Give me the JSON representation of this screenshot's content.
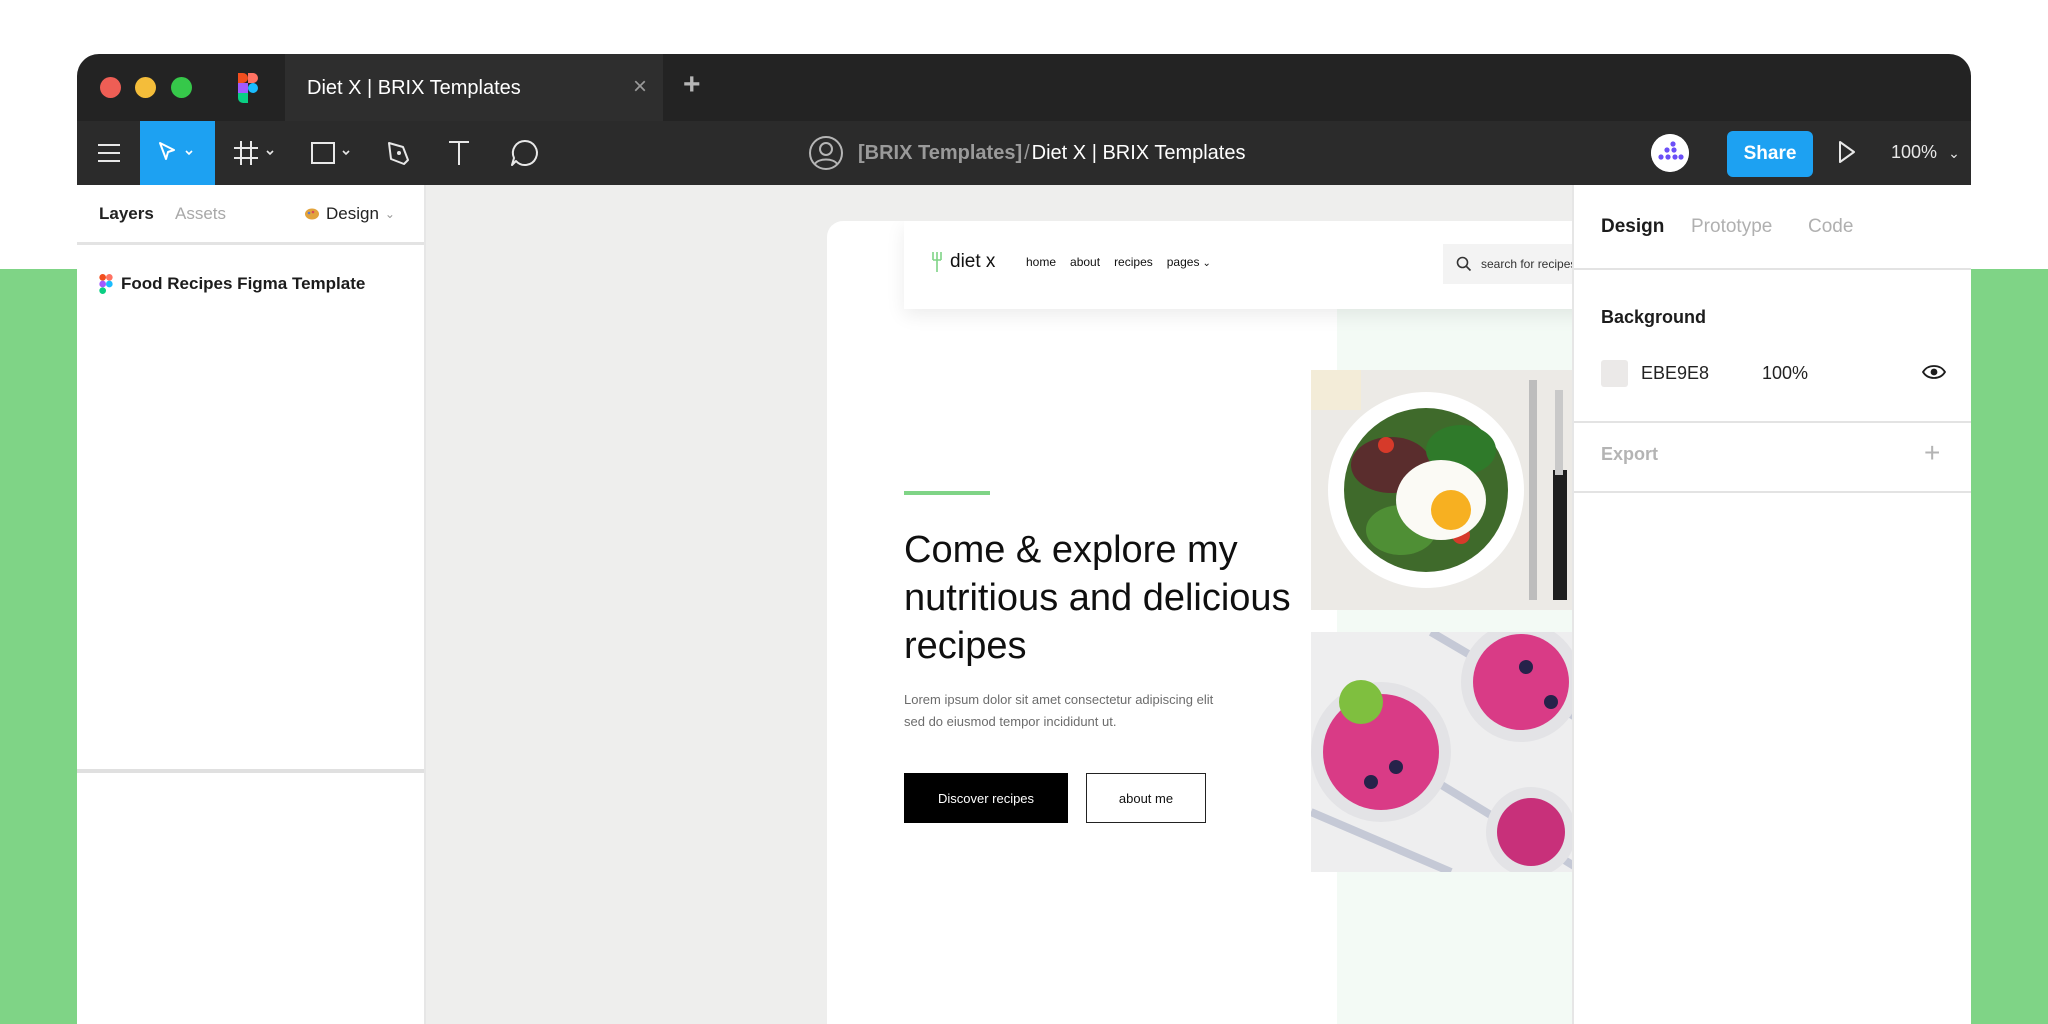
{
  "tab": {
    "title": "Diet X | BRIX Templates",
    "close_icon": "close-icon",
    "add_icon": "plus-icon"
  },
  "toolbar": {
    "breadcrumb_team": "[BRIX Templates]",
    "breadcrumb_sep": "/",
    "breadcrumb_file": "Diet X | BRIX Templates",
    "share_label": "Share",
    "zoom": "100%",
    "accent": "#1da1f2"
  },
  "left_panel": {
    "tab_layers": "Layers",
    "tab_assets": "Assets",
    "page_selector": "Design",
    "page_item": "Food Recipes Figma Template"
  },
  "site": {
    "brand": "diet x",
    "nav": [
      "home",
      "about",
      "recipes",
      "pages"
    ],
    "search_placeholder": "search for recipes",
    "hero_title": "Come & explore my nutritious and delicious recipes",
    "hero_text": "Lorem ipsum dolor sit amet consectetur adipiscing elit sed do eiusmod tempor incididunt ut.",
    "primary_button": "Discover recipes",
    "secondary_button": "about me",
    "accent": "#7fd486"
  },
  "right_panel": {
    "tabs": [
      "Design",
      "Prototype",
      "Code"
    ],
    "background_title": "Background",
    "background_hex": "EBE9E8",
    "background_opacity": "100%",
    "export_title": "Export"
  }
}
